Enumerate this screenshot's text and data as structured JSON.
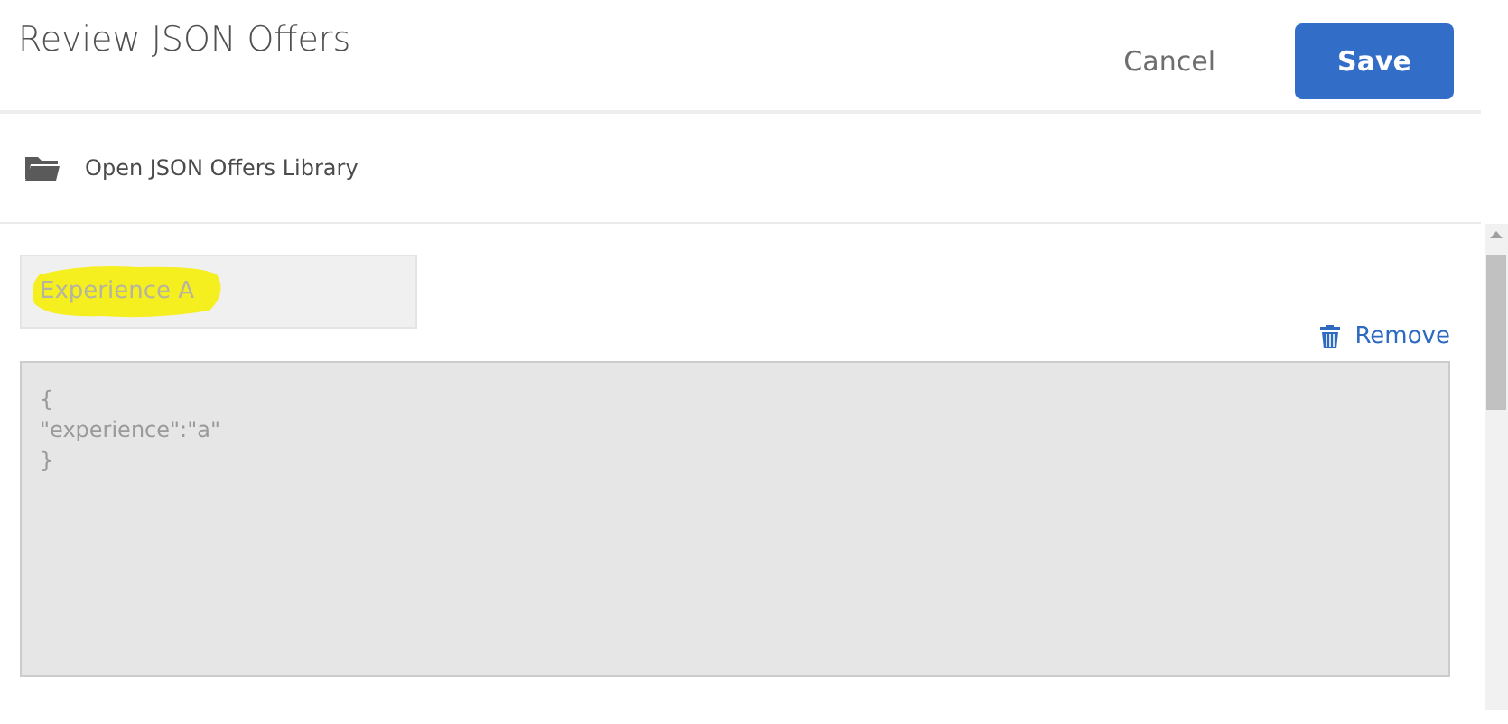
{
  "dialog": {
    "title": "Review JSON Offers",
    "buttons": [
      {
        "kind": "secondary",
        "label": "Cancel"
      },
      {
        "kind": "primary",
        "label": "Save"
      }
    ]
  },
  "library_link": {
    "label": "Open JSON Offers Library"
  },
  "offer": {
    "name": "Experience A",
    "remove_label": "Remove",
    "content": "{\n\"experience\":\"a\"\n}"
  }
}
